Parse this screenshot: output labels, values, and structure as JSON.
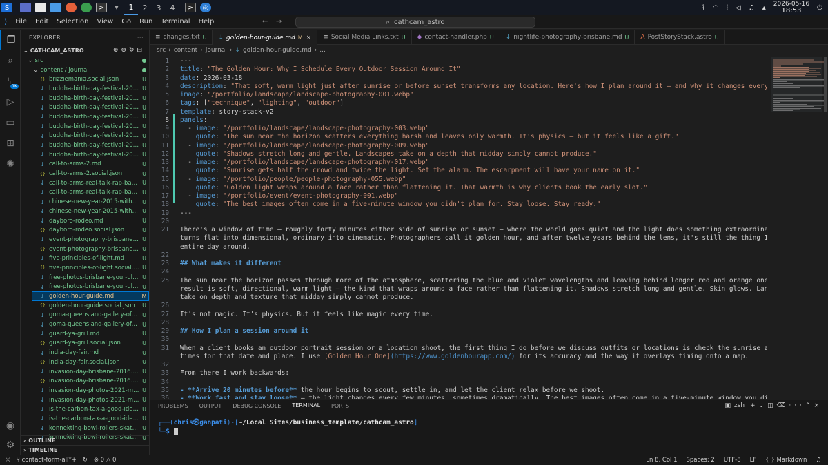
{
  "taskbar": {
    "workspaces": [
      "1",
      "2",
      "3",
      "4"
    ],
    "date": "2026-05-16",
    "time": "18:53"
  },
  "window": {
    "menu": [
      "File",
      "Edit",
      "Selection",
      "View",
      "Go",
      "Run",
      "Terminal",
      "Help"
    ],
    "search": "cathcam_astro"
  },
  "explorer": {
    "title": "EXPLORER",
    "project": "CATHCAM_ASTRO",
    "folders": [
      "src",
      "content / journal"
    ],
    "files": [
      {
        "name": "brizziemania.social.json",
        "status": "U"
      },
      {
        "name": "buddha-birth-day-festival-2011.md",
        "status": "U"
      },
      {
        "name": "buddha-birth-day-festival-2011.soci...",
        "status": "U"
      },
      {
        "name": "buddha-birth-day-festival-2012.md",
        "status": "U"
      },
      {
        "name": "buddha-birth-day-festival-2012.soci...",
        "status": "U"
      },
      {
        "name": "buddha-birth-day-festival-2013.md",
        "status": "U"
      },
      {
        "name": "buddha-birth-day-festival-2013.soci...",
        "status": "U"
      },
      {
        "name": "buddha-birth-day-festival-2015.md",
        "status": "U"
      },
      {
        "name": "buddha-birth-day-festival-2015.soci...",
        "status": "U"
      },
      {
        "name": "call-to-arms-2.md",
        "status": "U"
      },
      {
        "name": "call-to-arms-2.social.json",
        "status": "U"
      },
      {
        "name": "call-to-arms-real-talk-rap-battle-ev...",
        "status": "U"
      },
      {
        "name": "call-to-arms-real-talk-rap-battle-ev...",
        "status": "U"
      },
      {
        "name": "chinese-new-year-2015-with-lam-t...",
        "status": "U"
      },
      {
        "name": "chinese-new-year-2015-with-lam-t...",
        "status": "U"
      },
      {
        "name": "dayboro-rodeo.md",
        "status": "U"
      },
      {
        "name": "dayboro-rodeo.social.json",
        "status": "U"
      },
      {
        "name": "event-photography-brisbane.md",
        "status": "U"
      },
      {
        "name": "event-photography-brisbane.social.j...",
        "status": "U"
      },
      {
        "name": "five-principles-of-light.md",
        "status": "U"
      },
      {
        "name": "five-principles-of-light.social.json",
        "status": "U"
      },
      {
        "name": "free-photos-brisbane-your-ultimate...",
        "status": "U"
      },
      {
        "name": "free-photos-brisbane-your-ultimate...",
        "status": "U"
      },
      {
        "name": "golden-hour-guide.md",
        "status": "M"
      },
      {
        "name": "golden-hour-guide.social.json",
        "status": "U"
      },
      {
        "name": "goma-queensland-gallery-of-mode...",
        "status": "U"
      },
      {
        "name": "goma-queensland-gallery-of-mode...",
        "status": "U"
      },
      {
        "name": "guard-ya-grill.md",
        "status": "U"
      },
      {
        "name": "guard-ya-grill.social.json",
        "status": "U"
      },
      {
        "name": "india-day-fair.md",
        "status": "U"
      },
      {
        "name": "india-day-fair.social.json",
        "status": "U"
      },
      {
        "name": "invasion-day-brisbane-2016.md",
        "status": "U"
      },
      {
        "name": "invasion-day-brisbane-2016.social.js...",
        "status": "U"
      },
      {
        "name": "invasion-day-photos-2021-meanjin....",
        "status": "U"
      },
      {
        "name": "invasion-day-photos-2021-meanjin....",
        "status": "U"
      },
      {
        "name": "is-the-carbon-tax-a-good-idea.md",
        "status": "U"
      },
      {
        "name": "is-the-carbon-tax-a-good-idea.soci...",
        "status": "U"
      },
      {
        "name": "konnekting-bowl-rollers-skate-and-...",
        "status": "U"
      },
      {
        "name": "konnekting-bowl-rollers-skate-and-...",
        "status": "U"
      }
    ],
    "outline": "OUTLINE",
    "timeline": "TIMELINE"
  },
  "tabs": [
    {
      "label": "changes.txt",
      "status": "U",
      "icon": "≡"
    },
    {
      "label": "golden-hour-guide.md",
      "status": "M",
      "icon": "↓",
      "active": true
    },
    {
      "label": "Social Media Links.txt",
      "status": "U",
      "icon": "≡"
    },
    {
      "label": "contact-handler.php",
      "status": "U",
      "icon": "◆"
    },
    {
      "label": "nightlife-photography-brisbane.md",
      "status": "U",
      "icon": "↓"
    },
    {
      "label": "PostStoryStack.astro",
      "status": "U",
      "icon": "A"
    }
  ],
  "breadcrumb": [
    "src",
    "content",
    "journal",
    "golden-hour-guide.md",
    "..."
  ],
  "editor_lines": [
    {
      "n": "1",
      "c": [
        [
          "p",
          "---"
        ]
      ]
    },
    {
      "n": "2",
      "c": [
        [
          "k",
          "title"
        ],
        [
          "p",
          ": "
        ],
        [
          "s",
          "\"The Golden Hour: Why I Schedule Every Outdoor Session Around It\""
        ]
      ]
    },
    {
      "n": "3",
      "c": [
        [
          "k",
          "date"
        ],
        [
          "p",
          ": "
        ],
        [
          "t",
          "2026-03-18"
        ]
      ]
    },
    {
      "n": "4",
      "c": [
        [
          "k",
          "description"
        ],
        [
          "p",
          ": "
        ],
        [
          "s",
          "\"That soft, warm light just after sunrise or before sunset transforms any location. Here's how I plan around it — and why it changes everything.\""
        ]
      ]
    },
    {
      "n": "5",
      "c": [
        [
          "k",
          "image"
        ],
        [
          "p",
          ": "
        ],
        [
          "s",
          "\"/portfolio/landscape/landscape-photography-001.webp\""
        ]
      ]
    },
    {
      "n": "6",
      "c": [
        [
          "k",
          "tags"
        ],
        [
          "p",
          ": ["
        ],
        [
          "s",
          "\"technique\""
        ],
        [
          "p",
          ", "
        ],
        [
          "s",
          "\"lighting\""
        ],
        [
          "p",
          ", "
        ],
        [
          "s",
          "\"outdoor\""
        ],
        [
          "p",
          "]"
        ]
      ]
    },
    {
      "n": "7",
      "c": [
        [
          "k",
          "template"
        ],
        [
          "p",
          ": "
        ],
        [
          "t",
          "story-stack-v2"
        ]
      ]
    },
    {
      "n": "8",
      "c": [
        [
          "k",
          "panels"
        ],
        [
          "p",
          ":"
        ]
      ]
    },
    {
      "n": "9",
      "c": [
        [
          "p",
          "  - "
        ],
        [
          "k",
          "image"
        ],
        [
          "p",
          ": "
        ],
        [
          "s",
          "\"/portfolio/landscape/landscape-photography-003.webp\""
        ]
      ]
    },
    {
      "n": "10",
      "c": [
        [
          "p",
          "    "
        ],
        [
          "k",
          "quote"
        ],
        [
          "p",
          ": "
        ],
        [
          "s",
          "\"The sun near the horizon scatters everything harsh and leaves only warmth. It's physics — but it feels like a gift.\""
        ]
      ]
    },
    {
      "n": "11",
      "c": [
        [
          "p",
          "  - "
        ],
        [
          "k",
          "image"
        ],
        [
          "p",
          ": "
        ],
        [
          "s",
          "\"/portfolio/landscape/landscape-photography-009.webp\""
        ]
      ]
    },
    {
      "n": "12",
      "c": [
        [
          "p",
          "    "
        ],
        [
          "k",
          "quote"
        ],
        [
          "p",
          ": "
        ],
        [
          "s",
          "\"Shadows stretch long and gentle. Landscapes take on a depth that midday simply cannot produce.\""
        ]
      ]
    },
    {
      "n": "13",
      "c": [
        [
          "p",
          "  - "
        ],
        [
          "k",
          "image"
        ],
        [
          "p",
          ": "
        ],
        [
          "s",
          "\"/portfolio/landscape/landscape-photography-017.webp\""
        ]
      ]
    },
    {
      "n": "14",
      "c": [
        [
          "p",
          "    "
        ],
        [
          "k",
          "quote"
        ],
        [
          "p",
          ": "
        ],
        [
          "s",
          "\"Sunrise gets half the crowd and twice the light. Set the alarm. The escarpment will have your name on it.\""
        ]
      ]
    },
    {
      "n": "15",
      "c": [
        [
          "p",
          "  - "
        ],
        [
          "k",
          "image"
        ],
        [
          "p",
          ": "
        ],
        [
          "s",
          "\"/portfolio/people/people-photography-055.webp\""
        ]
      ]
    },
    {
      "n": "16",
      "c": [
        [
          "p",
          "    "
        ],
        [
          "k",
          "quote"
        ],
        [
          "p",
          ": "
        ],
        [
          "s",
          "\"Golden light wraps around a face rather than flattening it. That warmth is why clients book the early slot.\""
        ]
      ]
    },
    {
      "n": "17",
      "c": [
        [
          "p",
          "  - "
        ],
        [
          "k",
          "image"
        ],
        [
          "p",
          ": "
        ],
        [
          "s",
          "\"/portfolio/event/event-photography-001.webp\""
        ]
      ]
    },
    {
      "n": "18",
      "c": [
        [
          "p",
          "    "
        ],
        [
          "k",
          "quote"
        ],
        [
          "p",
          ": "
        ],
        [
          "s",
          "\"The best images often come in a five-minute window you didn't plan for. Stay loose. Stay ready.\""
        ]
      ]
    },
    {
      "n": "19",
      "c": [
        [
          "p",
          "---"
        ]
      ]
    },
    {
      "n": "20",
      "c": []
    },
    {
      "n": "21",
      "c": [
        [
          "t",
          "There's a window of time — roughly forty minutes either side of sunrise or sunset — where the world goes quiet and the light does something extraordinary. It"
        ]
      ]
    },
    {
      "n": "",
      "c": [
        [
          "t",
          "turns flat into dimensional, ordinary into cinematic. Photographers call it golden hour, and after twelve years behind the lens, it's still the thing I plan my"
        ]
      ]
    },
    {
      "n": "",
      "c": [
        [
          "t",
          "entire day around."
        ]
      ]
    },
    {
      "n": "22",
      "c": []
    },
    {
      "n": "23",
      "c": [
        [
          "h",
          "## What makes it different"
        ]
      ]
    },
    {
      "n": "24",
      "c": []
    },
    {
      "n": "25",
      "c": [
        [
          "t",
          "The sun near the horizon passes through more of the atmosphere, scattering the blue and violet wavelengths and leaving behind longer red and orange ones. The"
        ]
      ]
    },
    {
      "n": "",
      "c": [
        [
          "t",
          "result is soft, directional, warm light — the kind that wraps around a face rather than flattening it. Shadows stretch long and gentle. Skin glows. Landscapes"
        ]
      ]
    },
    {
      "n": "",
      "c": [
        [
          "t",
          "take on depth and texture that midday simply cannot produce."
        ]
      ]
    },
    {
      "n": "26",
      "c": []
    },
    {
      "n": "27",
      "c": [
        [
          "t",
          "It's not magic. It's physics. But it feels like magic every time."
        ]
      ]
    },
    {
      "n": "28",
      "c": []
    },
    {
      "n": "29",
      "c": [
        [
          "h",
          "## How I plan a session around it"
        ]
      ]
    },
    {
      "n": "30",
      "c": []
    },
    {
      "n": "31",
      "c": [
        [
          "t",
          "When a client books an outdoor portrait session or a location shoot, the first thing I do before we discuss outfits or locations is check the sunrise and sunset"
        ]
      ]
    },
    {
      "n": "",
      "c": [
        [
          "t",
          "times for that date and place. I use "
        ],
        [
          "l",
          "[Golden Hour One]"
        ],
        [
          "u",
          "(https://www.goldenhourapp.com/)"
        ],
        [
          "t",
          " for its accuracy and the way it overlays timing onto a map."
        ]
      ]
    },
    {
      "n": "32",
      "c": []
    },
    {
      "n": "33",
      "c": [
        [
          "t",
          "From there I work backwards:"
        ]
      ]
    },
    {
      "n": "34",
      "c": []
    },
    {
      "n": "35",
      "c": [
        [
          "b",
          "- **Arrive 20 minutes before**"
        ],
        [
          "t",
          " the hour begins to scout, settle in, and let the client relax before we shoot."
        ]
      ]
    },
    {
      "n": "36",
      "c": [
        [
          "b",
          "- **Work fast and stay loose**"
        ],
        [
          "t",
          " — the light changes every few minutes, sometimes dramatically. The best images often come in a five-minute window you didn't"
        ]
      ]
    },
    {
      "n": "",
      "c": [
        [
          "t",
          "expect."
        ]
      ]
    }
  ],
  "panel": {
    "tabs": [
      "PROBLEMS",
      "OUTPUT",
      "DEBUG CONSOLE",
      "TERMINAL",
      "PORTS"
    ],
    "active_tab": "TERMINAL",
    "shell": "zsh",
    "prompt_user": "chris",
    "prompt_host": "ganpati",
    "prompt_path": "~/Local Sites/business_template/cathcam_astro"
  },
  "status": {
    "branch": "contact-form-all*+",
    "errors": "0",
    "warnings": "0",
    "position": "Ln 8, Col 1",
    "spaces": "Spaces: 2",
    "encoding": "UTF-8",
    "eol": "LF",
    "language": "Markdown"
  },
  "colors": {
    "accent": "#0078d4",
    "modified": "#e2c08d",
    "untracked": "#73c991"
  }
}
